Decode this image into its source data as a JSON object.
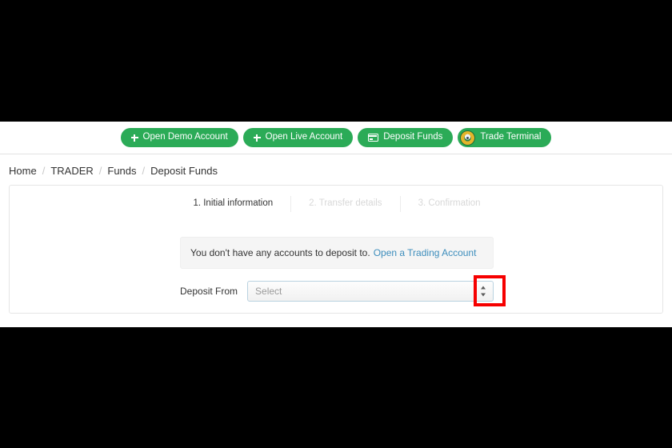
{
  "action_bar": {
    "buttons": [
      {
        "label": "Open Demo Account",
        "icon": "plus-icon"
      },
      {
        "label": "Open Live Account",
        "icon": "plus-icon"
      },
      {
        "label": "Deposit Funds",
        "icon": "credit-card-icon"
      },
      {
        "label": "Trade Terminal",
        "icon": "broker-logo-icon"
      }
    ],
    "accent_color": "#2bab57"
  },
  "breadcrumb": {
    "separator": "/",
    "items": [
      {
        "label": "Home"
      },
      {
        "label": "TRADER"
      },
      {
        "label": "Funds"
      },
      {
        "label": "Deposit Funds"
      }
    ]
  },
  "card": {
    "steps": [
      {
        "label": "1. Initial information",
        "state": "active"
      },
      {
        "label": "2. Transfer details",
        "state": "inactive"
      },
      {
        "label": "3. Confirmation",
        "state": "inactive"
      }
    ],
    "alert": {
      "message": "You don't have any accounts to deposit to.",
      "link_label": "Open a Trading Account",
      "link_color": "#3c8dbc"
    },
    "form": {
      "deposit_from_label": "Deposit From",
      "deposit_from_value": "Select",
      "deposit_from_placeholder": "Select"
    }
  },
  "annotation": {
    "color": "#f60000",
    "target": "select-dropdown-arrow"
  }
}
